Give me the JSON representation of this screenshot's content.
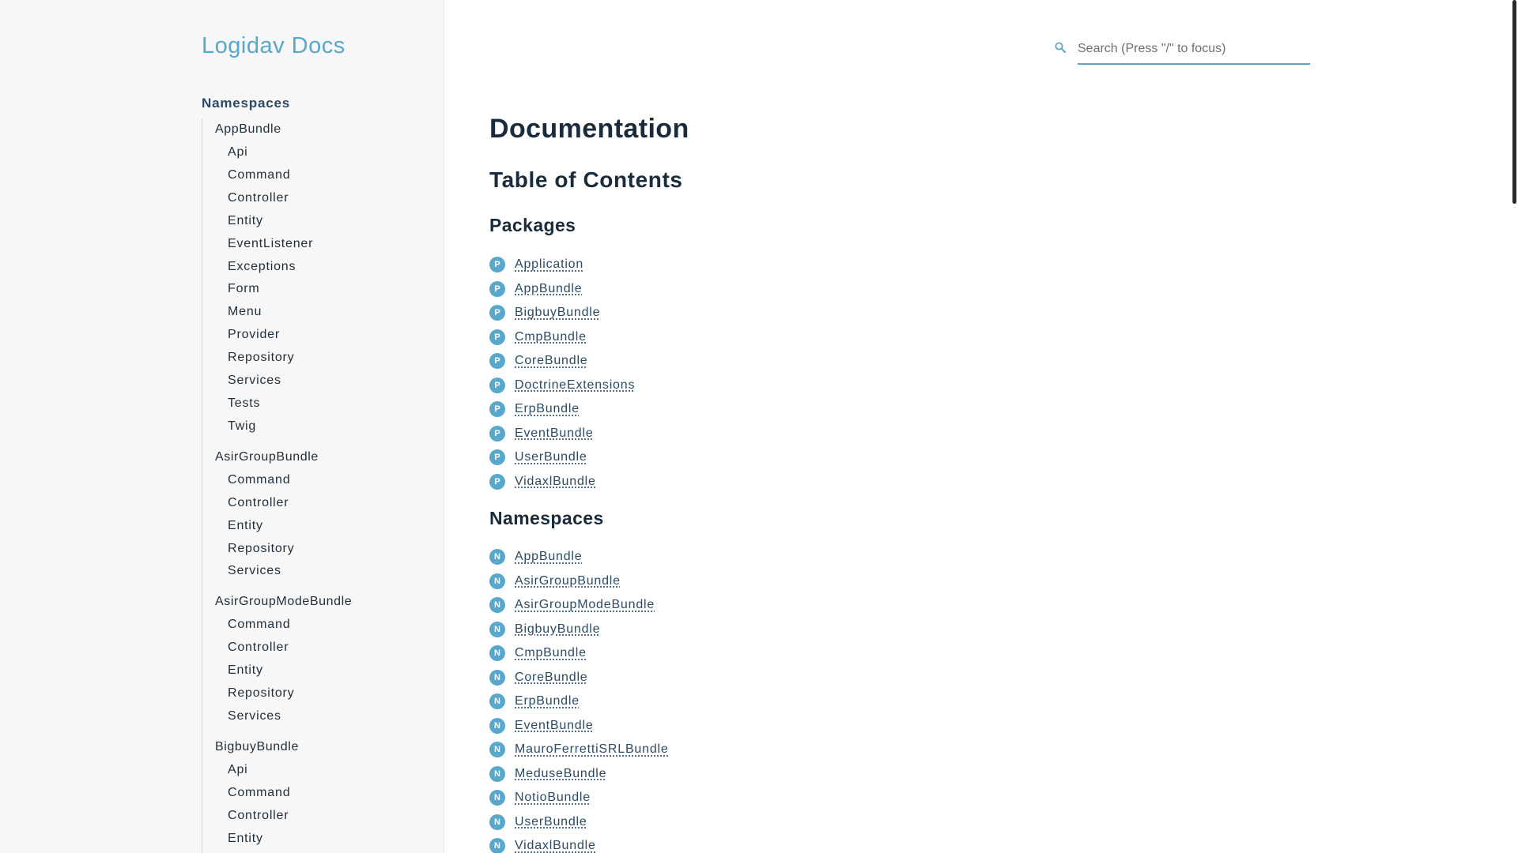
{
  "brand": {
    "title": "Logidav Docs"
  },
  "sidebar": {
    "section_title": "Namespaces",
    "groups": [
      {
        "label": "AppBundle",
        "items": [
          "Api",
          "Command",
          "Controller",
          "Entity",
          "EventListener",
          "Exceptions",
          "Form",
          "Menu",
          "Provider",
          "Repository",
          "Services",
          "Tests",
          "Twig"
        ]
      },
      {
        "label": "AsirGroupBundle",
        "items": [
          "Command",
          "Controller",
          "Entity",
          "Repository",
          "Services"
        ]
      },
      {
        "label": "AsirGroupModeBundle",
        "items": [
          "Command",
          "Controller",
          "Entity",
          "Repository",
          "Services"
        ]
      },
      {
        "label": "BigbuyBundle",
        "items": [
          "Api",
          "Command",
          "Controller",
          "Entity"
        ]
      }
    ]
  },
  "search": {
    "placeholder": "Search (Press \"/\" to focus)",
    "value": "",
    "icon": "search-icon"
  },
  "main": {
    "title": "Documentation",
    "toc_title": "Table of Contents",
    "packages": {
      "heading": "Packages",
      "badge": "P",
      "items": [
        "Application",
        "AppBundle",
        "BigbuyBundle",
        "CmpBundle",
        "CoreBundle",
        "DoctrineExtensions",
        "ErpBundle",
        "EventBundle",
        "UserBundle",
        "VidaxlBundle"
      ]
    },
    "namespaces": {
      "heading": "Namespaces",
      "badge": "N",
      "items": [
        "AppBundle",
        "AsirGroupBundle",
        "AsirGroupModeBundle",
        "BigbuyBundle",
        "CmpBundle",
        "CoreBundle",
        "ErpBundle",
        "EventBundle",
        "MauroFerrettiSRLBundle",
        "MeduseBundle",
        "NotioBundle",
        "UserBundle",
        "VidaxlBundle"
      ]
    }
  },
  "colors": {
    "accent": "#5aa7cc",
    "text": "#1a2b3c",
    "sidebar_bg": "#f7f7f7"
  }
}
